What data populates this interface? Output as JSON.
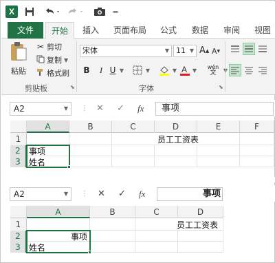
{
  "qat": {
    "logo": "X",
    "save_icon": "save-icon",
    "undo_icon": "undo-icon",
    "redo_icon": "redo-icon",
    "camera_icon": "camera-icon",
    "customize": "="
  },
  "tabs": {
    "file": "文件",
    "home": "开始",
    "insert": "插入",
    "layout": "页面布局",
    "formulas": "公式",
    "data": "数据",
    "review": "审阅",
    "view": "视图"
  },
  "ribbon": {
    "clipboard": {
      "paste": "粘贴",
      "cut": "剪切",
      "copy": "复制",
      "format_painter": "格式刷",
      "group_label": "剪贴板"
    },
    "font": {
      "font_name": "宋体",
      "font_size": "11",
      "bold": "B",
      "italic": "I",
      "underline": "U",
      "wen": "wén",
      "group_label": "字体"
    }
  },
  "sheet1": {
    "namebox": "A2",
    "formula": "事项",
    "columns": [
      "A",
      "B",
      "C",
      "D",
      "E",
      "F"
    ],
    "rows": [
      "1",
      "2",
      "3"
    ],
    "cells": {
      "D1": "员工工资表",
      "A2": "事项",
      "A3": "姓名"
    }
  },
  "sheet2": {
    "namebox": "A2",
    "formula": "事项",
    "columns": [
      "A",
      "B",
      "C",
      "D"
    ],
    "rows": [
      "1",
      "2",
      "3"
    ],
    "cells": {
      "D1": "员工工资表",
      "A2": "事项",
      "A3": "姓名"
    }
  },
  "colors": {
    "excel_green": "#217346",
    "file_tab_green": "#217346",
    "font_color_red": "#e01e1e",
    "highlight_yellow": "#ffff00"
  }
}
